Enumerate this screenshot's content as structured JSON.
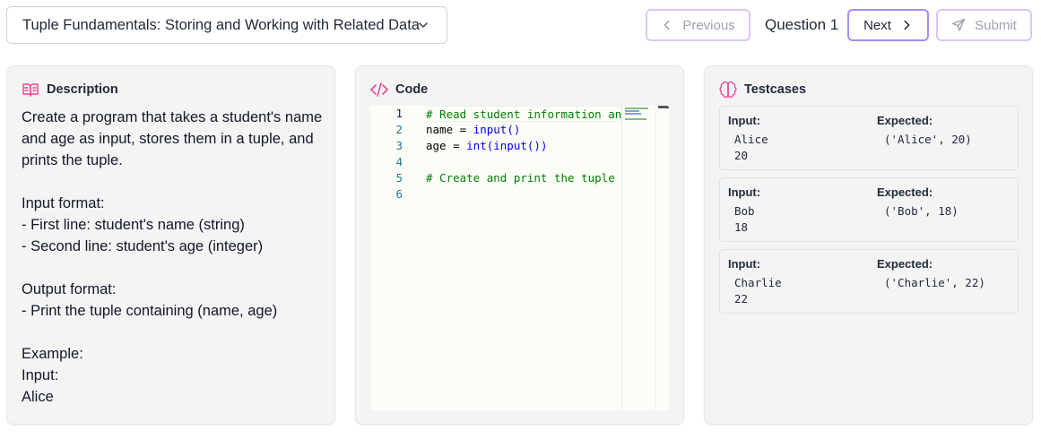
{
  "header": {
    "title": "Tuple Fundamentals: Storing and Working with Related Data",
    "prev_label": "Previous",
    "question_label": "Question 1",
    "next_label": "Next",
    "submit_label": "Submit"
  },
  "description": {
    "heading": "Description",
    "text": "Create a program that takes a student's name and age as input, stores them in a tuple, and prints the tuple.\n\nInput format:\n- First line: student's name (string)\n- Second line: student's age (integer)\n\nOutput format:\n- Print the tuple containing (name, age)\n\nExample:\nInput:\nAlice"
  },
  "code": {
    "heading": "Code",
    "line_numbers": [
      "1",
      "2",
      "3",
      "4",
      "5",
      "6"
    ],
    "line1": "# Read student information and",
    "line2_pre": "name = ",
    "line2_fn": "input()",
    "line3_pre": "age = ",
    "line3_fn": "int(input())",
    "line5": "# Create and print the tuple"
  },
  "testcases": {
    "heading": "Testcases",
    "input_label": "Input:",
    "expected_label": "Expected:",
    "items": [
      {
        "input": "Alice\n20",
        "expected": "('Alice', 20)"
      },
      {
        "input": "Bob\n18",
        "expected": "('Bob', 18)"
      },
      {
        "input": "Charlie\n22",
        "expected": "('Charlie', 22)"
      }
    ]
  },
  "colors": {
    "accent": "#a78bfa",
    "accent_light": "#dcc7f3",
    "icon_pink": "#ec4899",
    "comment": "#008000",
    "keyword_fn": "#0000ff"
  },
  "icons": {
    "title_dropdown": "chevron-down-icon",
    "prev": "chevron-left-icon",
    "next": "chevron-right-icon",
    "submit": "send-icon",
    "description": "book-open-icon",
    "code": "code-icon",
    "testcases": "brain-icon"
  }
}
